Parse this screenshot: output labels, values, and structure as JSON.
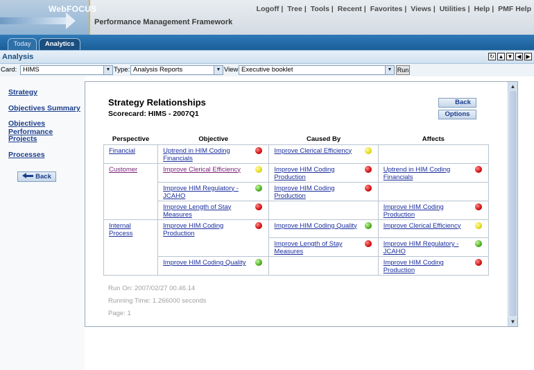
{
  "app": {
    "logo": "WebFOCUS",
    "framework_title": "Performance Management Framework"
  },
  "top_links": [
    "Logoff",
    "Tree",
    "Tools",
    "Recent",
    "Favorites",
    "Views",
    "Utilities",
    "Help",
    "PMF Help"
  ],
  "tabs": [
    {
      "label": "Today"
    },
    {
      "label": "Analytics"
    }
  ],
  "analysis": {
    "title": "Analysis",
    "controls": [
      "refresh-icon",
      "up-icon",
      "down-icon",
      "left-icon",
      "right-icon"
    ]
  },
  "selectors": {
    "card": {
      "label": "Card:",
      "value": "HIMS"
    },
    "type": {
      "label": "Type:",
      "value": "Analysis Reports"
    },
    "view": {
      "label": "View:",
      "value": "Executive booklet"
    },
    "run_label": "Run"
  },
  "leftnav": {
    "items": [
      "Strategy",
      "Objectives Summary",
      "Objectives Performance",
      "Projects",
      "Processes"
    ],
    "back_label": "Back"
  },
  "report": {
    "title": "Strategy Relationships",
    "subtitle": "Scorecard: HIMS - 2007Q1",
    "back_label": "Back",
    "options_label": "Options",
    "columns": [
      "Perspective",
      "Objective",
      "Caused By",
      "Affects"
    ],
    "rows": [
      {
        "perspective": "Financial",
        "objective": "Uptrend in HIM Coding Financials",
        "objective_status": "red",
        "caused_by": "Improve Clerical Efficiency",
        "caused_by_status": "yellow",
        "affects": "",
        "affects_status": ""
      },
      {
        "perspective": "Customer",
        "objective": "Improve Clerical Efficiency",
        "objective_status": "yellow",
        "caused_by": "Improve HIM Coding Production",
        "caused_by_status": "red",
        "affects": "Uptrend in HIM Coding Financials",
        "affects_status": "red"
      },
      {
        "perspective": "",
        "objective": "Improve HIM Regulatory - JCAHO",
        "objective_status": "green",
        "caused_by": "Improve HIM Coding Production",
        "caused_by_status": "red",
        "affects": "",
        "affects_status": ""
      },
      {
        "perspective": "",
        "objective": "Improve Length of Stay Measures",
        "objective_status": "red",
        "caused_by": "",
        "caused_by_status": "",
        "affects": "Improve HIM Coding Production",
        "affects_status": "red"
      },
      {
        "perspective": "Internal Process",
        "objective": "Improve HIM Coding Production",
        "objective_status": "red",
        "caused_by": "Improve HIM Coding Quality",
        "caused_by_status": "green",
        "affects": "Improve Clerical Efficiency",
        "affects_status": "yellow"
      },
      {
        "perspective": "",
        "objective": "",
        "objective_status": "",
        "caused_by": "Improve Length of Stay Measures",
        "caused_by_status": "red",
        "affects": "Improve HIM Regulatory - JCAHO",
        "affects_status": "green"
      },
      {
        "perspective": "",
        "objective": "Improve HIM Coding Quality",
        "objective_status": "green",
        "caused_by": "",
        "caused_by_status": "",
        "affects": "Improve HIM Coding Production",
        "affects_status": "red"
      }
    ],
    "footer": {
      "run_on": "Run On: 2007/02/27 00.46.14",
      "running_time": "Running Time: 1.266000 seconds",
      "page": "Page: 1"
    }
  },
  "colors": {
    "tab_bar": "#1a5e98",
    "link": "#1a2e9c",
    "visited_link": "#7a2378",
    "accent": "#e0b438"
  }
}
